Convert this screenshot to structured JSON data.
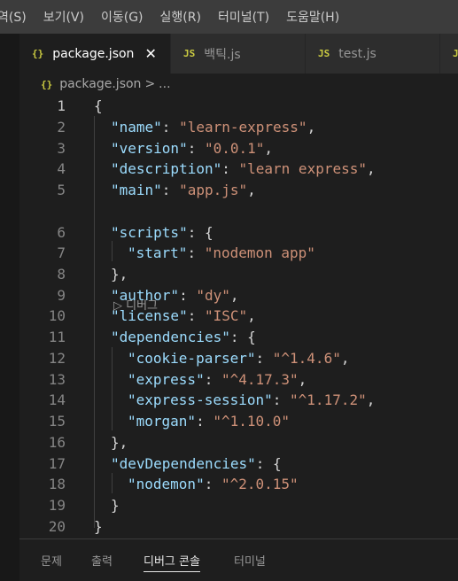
{
  "menubar": {
    "items": [
      "역(S)",
      "보기(V)",
      "이동(G)",
      "실행(R)",
      "터미널(T)",
      "도움말(H)"
    ]
  },
  "tabs": [
    {
      "icon": "{}",
      "label": "package.json",
      "close": "✕"
    },
    {
      "icon": "JS",
      "label": "백틱.js"
    },
    {
      "icon": "JS",
      "label": "test.js"
    },
    {
      "icon": "JS",
      "label": ""
    }
  ],
  "breadcrumb": {
    "icon": "{}",
    "file": "package.json",
    "separator": ">",
    "rest": "..."
  },
  "editor": {
    "line_numbers": [
      "1",
      "2",
      "3",
      "4",
      "5",
      "6",
      "7",
      "8",
      "9",
      "10",
      "11",
      "12",
      "13",
      "14",
      "15",
      "16",
      "17",
      "18",
      "19",
      "20"
    ],
    "codelens": "▷ 디버그",
    "lines": [
      [
        "{"
      ],
      [
        "\"name\"",
        ": ",
        "\"learn-express\"",
        ","
      ],
      [
        "\"version\"",
        ": ",
        "\"0.0.1\"",
        ","
      ],
      [
        "\"description\"",
        ": ",
        "\"learn express\"",
        ","
      ],
      [
        "\"main\"",
        ": ",
        "\"app.js\"",
        ","
      ],
      [
        "\"scripts\"",
        ": {"
      ],
      [
        "\"start\"",
        ": ",
        "\"nodemon app\""
      ],
      [
        "},"
      ],
      [
        "\"author\"",
        ": ",
        "\"dy\"",
        ","
      ],
      [
        "\"license\"",
        ": ",
        "\"ISC\"",
        ","
      ],
      [
        "\"dependencies\"",
        ": {"
      ],
      [
        "\"cookie-parser\"",
        ": ",
        "\"^1.4.6\"",
        ","
      ],
      [
        "\"express\"",
        ": ",
        "\"^4.17.3\"",
        ","
      ],
      [
        "\"express-session\"",
        ": ",
        "\"^1.17.2\"",
        ","
      ],
      [
        "\"morgan\"",
        ": ",
        "\"^1.10.0\""
      ],
      [
        "},"
      ],
      [
        "\"devDependencies\"",
        ": {"
      ],
      [
        "\"nodemon\"",
        ": ",
        "\"^2.0.15\""
      ],
      [
        "}"
      ],
      [
        "}"
      ]
    ]
  },
  "panel": {
    "tabs": [
      "문제",
      "출력",
      "디버그 콘솔",
      "터미널"
    ],
    "active": "디버그 콘솔"
  }
}
